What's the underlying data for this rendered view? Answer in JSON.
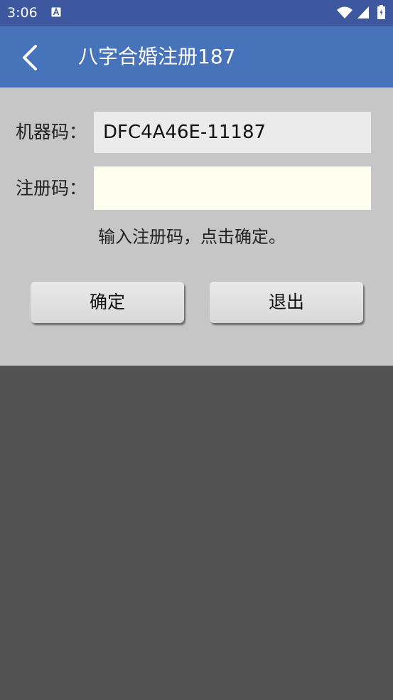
{
  "status_bar": {
    "time": "3:06",
    "icons": [
      "a-notification-icon",
      "wifi-icon",
      "signal-icon",
      "battery-charging-icon"
    ]
  },
  "app_bar": {
    "title": "八字合婚注册187",
    "back_icon": "chevron-left-icon"
  },
  "form": {
    "machine_code_label": "机器码：",
    "machine_code_value": "DFC4A46E-11187",
    "reg_code_label": "注册码：",
    "reg_code_value": "",
    "reg_code_placeholder": "",
    "hint": "输入注册码，点击确定。"
  },
  "buttons": {
    "ok_label": "确定",
    "exit_label": "退出"
  },
  "colors": {
    "status_bar": "#3d589e",
    "app_bar": "#4673b9",
    "dialog_bg": "#c6c6c6",
    "machine_code_bg": "#ebebeb",
    "reg_input_bg": "#fffff0",
    "screen_bg": "#525252"
  }
}
